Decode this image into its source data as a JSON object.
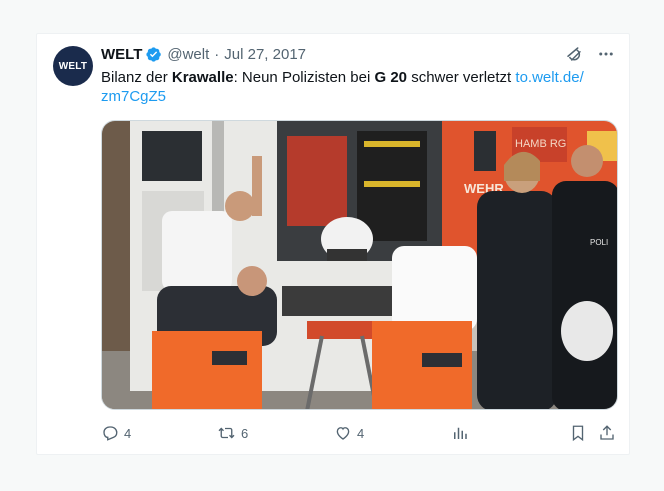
{
  "tweet": {
    "display_name": "WELT",
    "avatar_text": "WELT",
    "handle": "@welt",
    "separator": "·",
    "date": "Jul 27, 2017",
    "text_parts": [
      {
        "text": "Bilanz der ",
        "bold": false
      },
      {
        "text": "Krawalle",
        "bold": true
      },
      {
        "text": ": Neun Polizisten bei ",
        "bold": false
      },
      {
        "text": "G 20",
        "bold": true
      },
      {
        "text": " schwer verletzt ",
        "bold": false
      }
    ],
    "link_line1": "to.welt.de/",
    "link_line2": "zm7CgZ5"
  },
  "media": {
    "vehicle_text": "WEHR",
    "panel_text": "HAMB RG",
    "uniform_text": "POLI"
  },
  "actions": {
    "replies": "4",
    "retweets": "6",
    "likes": "4"
  },
  "colors": {
    "link": "#1d9bf0",
    "verified": "#1d9bf0",
    "secondary_text": "#536471",
    "avatar_bg": "#1a2b4c"
  },
  "icons": [
    "verified-badge-icon",
    "grok-icon",
    "more-icon",
    "reply-icon",
    "retweet-icon",
    "like-icon",
    "views-icon",
    "bookmark-icon",
    "share-icon"
  ]
}
